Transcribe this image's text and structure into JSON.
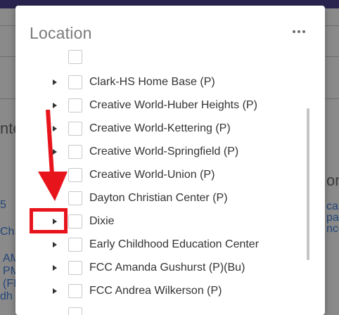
{
  "background": {
    "fragments": [
      "nte",
      "om",
      "5",
      "Ch",
      "AM",
      "PM",
      "(FI",
      "dh",
      "ca",
      "pa",
      "nce"
    ]
  },
  "modal": {
    "title": "Location",
    "more_icon": "ellipsis-horizontal-icon",
    "items": [
      {
        "label": "",
        "has_children": false
      },
      {
        "label": "Clark-HS Home Base (P)",
        "has_children": true
      },
      {
        "label": "Creative World-Huber Heights (P)",
        "has_children": true
      },
      {
        "label": "Creative World-Kettering (P)",
        "has_children": true
      },
      {
        "label": "Creative World-Springfield (P)",
        "has_children": true
      },
      {
        "label": "Creative World-Union (P)",
        "has_children": true
      },
      {
        "label": "Dayton Christian Center (P)",
        "has_children": false
      },
      {
        "label": "Dixie",
        "has_children": true
      },
      {
        "label": "Early Childhood Education Center",
        "has_children": true
      },
      {
        "label": "FCC Amanda Gushurst (P)(Bu)",
        "has_children": true
      },
      {
        "label": "FCC Andrea Wilkerson (P)",
        "has_children": true
      }
    ]
  },
  "annotation": {
    "color": "#e8141c",
    "target": "Dixie"
  }
}
